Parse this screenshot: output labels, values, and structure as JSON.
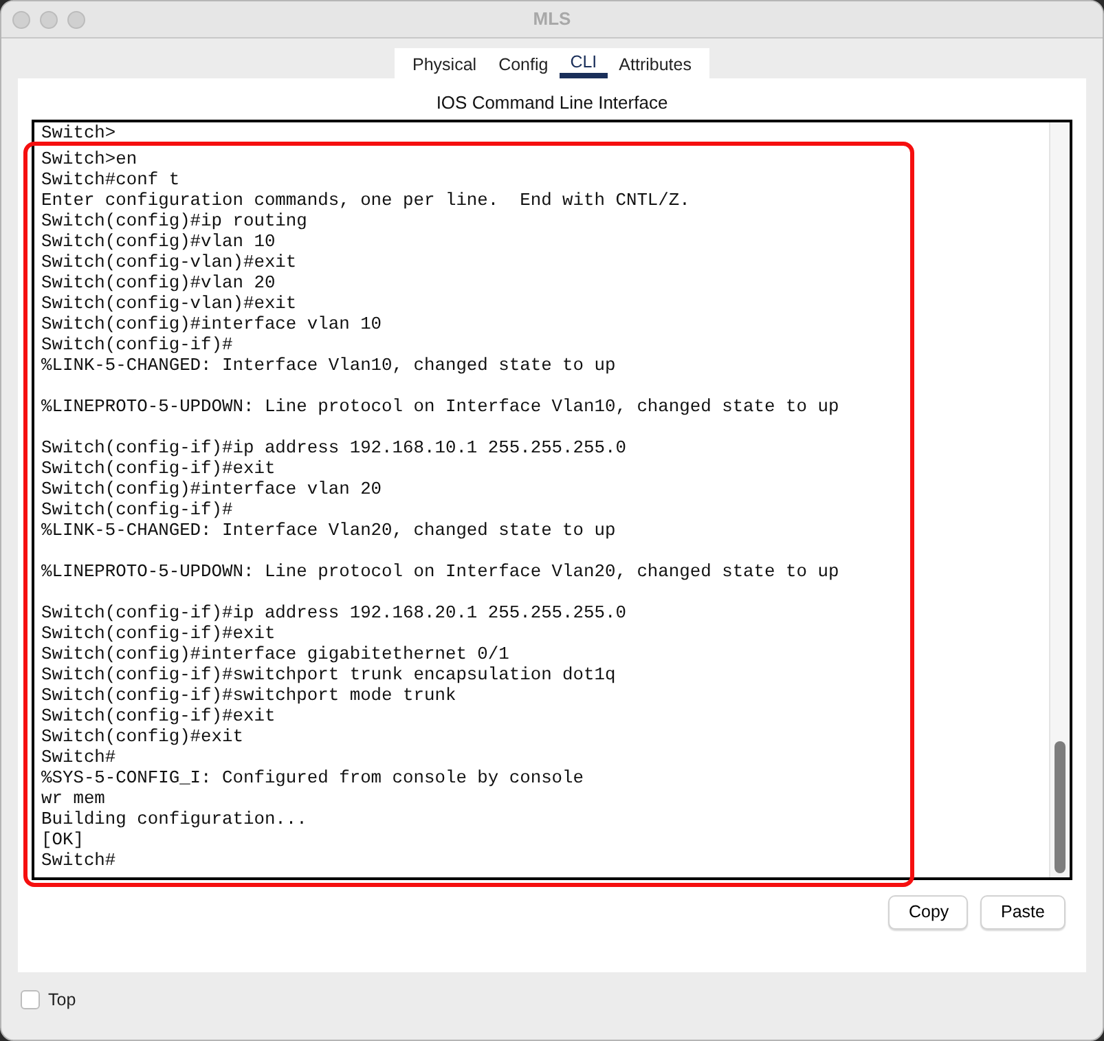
{
  "window": {
    "title": "MLS"
  },
  "tabs": [
    {
      "label": "Physical",
      "selected": false
    },
    {
      "label": "Config",
      "selected": false
    },
    {
      "label": "CLI",
      "selected": true
    },
    {
      "label": "Attributes",
      "selected": false
    }
  ],
  "panel": {
    "heading": "IOS Command Line Interface"
  },
  "console": {
    "lines": [
      {
        "kind": "text",
        "text": "Switch>"
      },
      {
        "kind": "text",
        "text": "Switch>en"
      },
      {
        "kind": "text",
        "text": "Switch#conf t"
      },
      {
        "kind": "text",
        "text": "Enter configuration commands, one per line.  End with CNTL/Z."
      },
      {
        "kind": "text",
        "text": "Switch(config)#ip routing"
      },
      {
        "kind": "text",
        "text": "Switch(config)#vlan 10"
      },
      {
        "kind": "text",
        "text": "Switch(config-vlan)#exit"
      },
      {
        "kind": "text",
        "text": "Switch(config)#vlan 20"
      },
      {
        "kind": "text",
        "text": "Switch(config-vlan)#exit"
      },
      {
        "kind": "text",
        "text": "Switch(config)#interface vlan 10"
      },
      {
        "kind": "text",
        "text": "Switch(config-if)#"
      },
      {
        "kind": "text",
        "text": "%LINK-5-CHANGED: Interface Vlan10, changed state to up"
      },
      {
        "kind": "blank"
      },
      {
        "kind": "text",
        "text": "%LINEPROTO-5-UPDOWN: Line protocol on Interface Vlan10, changed state to up"
      },
      {
        "kind": "blank"
      },
      {
        "kind": "text",
        "text": "Switch(config-if)#ip address 192.168.10.1 255.255.255.0"
      },
      {
        "kind": "text",
        "text": "Switch(config-if)#exit"
      },
      {
        "kind": "text",
        "text": "Switch(config)#interface vlan 20"
      },
      {
        "kind": "text",
        "text": "Switch(config-if)#"
      },
      {
        "kind": "text",
        "text": "%LINK-5-CHANGED: Interface Vlan20, changed state to up"
      },
      {
        "kind": "blank"
      },
      {
        "kind": "text",
        "text": "%LINEPROTO-5-UPDOWN: Line protocol on Interface Vlan20, changed state to up"
      },
      {
        "kind": "blank"
      },
      {
        "kind": "text",
        "text": "Switch(config-if)#ip address 192.168.20.1 255.255.255.0"
      },
      {
        "kind": "text",
        "text": "Switch(config-if)#exit"
      },
      {
        "kind": "text",
        "text": "Switch(config)#interface gigabitethernet 0/1"
      },
      {
        "kind": "text",
        "text": "Switch(config-if)#switchport trunk encapsulation dot1q"
      },
      {
        "kind": "text",
        "text": "Switch(config-if)#switchport mode trunk"
      },
      {
        "kind": "text",
        "text": "Switch(config-if)#exit"
      },
      {
        "kind": "text",
        "text": "Switch(config)#exit"
      },
      {
        "kind": "text",
        "text": "Switch#"
      },
      {
        "kind": "text",
        "text": "%SYS-5-CONFIG_I: Configured from console by console"
      },
      {
        "kind": "text",
        "text": "wr mem"
      },
      {
        "kind": "text",
        "text": "Building configuration..."
      },
      {
        "kind": "text",
        "text": "[OK]"
      },
      {
        "kind": "text",
        "text": "Switch#"
      }
    ]
  },
  "buttons": [
    {
      "label": "Copy"
    },
    {
      "label": "Paste"
    }
  ],
  "top_option": {
    "label": "Top",
    "checked": false
  }
}
